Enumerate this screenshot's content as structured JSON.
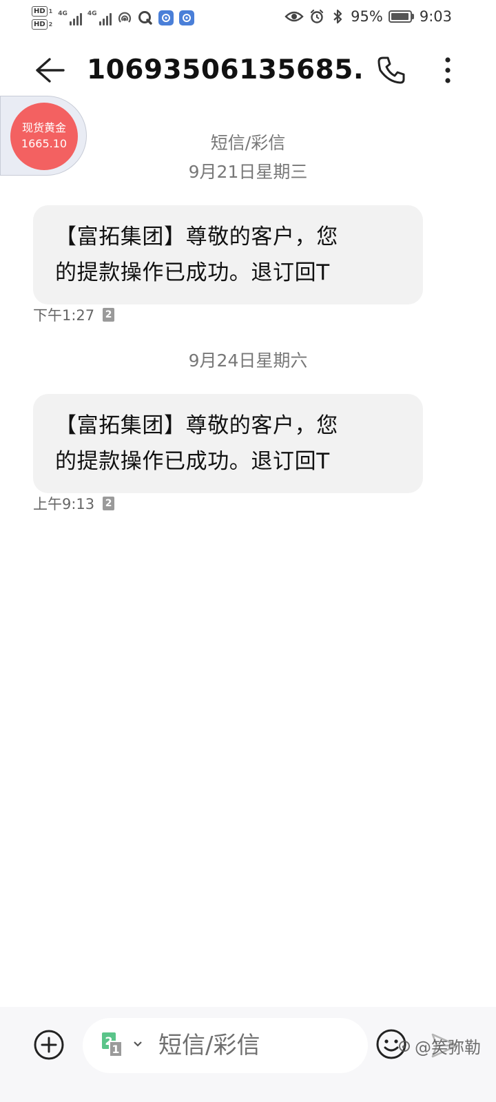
{
  "status_bar": {
    "hd1": "HD",
    "hd1_sim": "1",
    "hd2": "HD",
    "hd2_sim": "2",
    "net1": "4G",
    "net2": "4G",
    "battery": "95%",
    "time": "9:03",
    "icons": [
      "hd-icon",
      "signal-icon",
      "hotspot-icon",
      "app-q-icon",
      "app-notify-icon",
      "eye-icon",
      "alarm-icon",
      "bluetooth-icon",
      "battery-icon"
    ]
  },
  "header": {
    "title": "10693506135685..."
  },
  "gold_widget": {
    "name": "现货黄金",
    "price": "1665.10",
    "color": "#f36161"
  },
  "conversation": {
    "type_label": "短信/彩信",
    "groups": [
      {
        "date": "9月21日星期三",
        "message": {
          "text_line1": "【富拓集团】尊敬的客户，您",
          "text_line2": "的提款操作已成功。退订回T",
          "time": "下午1:27",
          "sim": "2"
        }
      },
      {
        "date": "9月24日星期六",
        "message": {
          "text_line1": "【富拓集团】尊敬的客户，您",
          "text_line2": "的提款操作已成功。退订回T",
          "time": "上午9:13",
          "sim": "2"
        }
      }
    ]
  },
  "composer": {
    "placeholder": "短信/彩信",
    "sim_primary": "2",
    "sim_secondary": "1",
    "watermark": "@笑弥勒"
  },
  "colors": {
    "bubble": "#f2f2f2",
    "meta_text": "#777777",
    "sim_active": "#5ac489"
  }
}
